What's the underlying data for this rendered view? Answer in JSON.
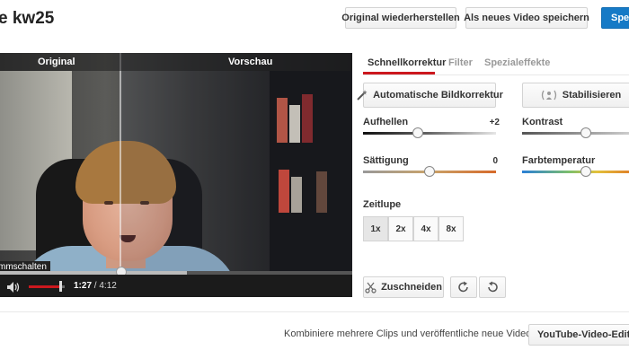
{
  "header": {
    "title": "e kw25",
    "restore_label": "Original wiederherstellen",
    "save_new_label": "Als neues Video speichern",
    "save_label": "Speic"
  },
  "video": {
    "original_label": "Original",
    "preview_label": "Vorschau",
    "mute_tooltip": "mmschalten",
    "current_time": "1:27",
    "total_time": "/ 4:12",
    "progress_fraction": 0.345,
    "played_fraction": 0.53,
    "volume_fraction": 0.9
  },
  "tabs": [
    {
      "label": "Schnellkorrektur",
      "active": true
    },
    {
      "label": "Filter",
      "active": false
    },
    {
      "label": "Spezialeffekte",
      "active": false
    }
  ],
  "quickfix": {
    "auto_fix_label": "Automatische Bildkorrektur",
    "stabilize_label": "Stabilisieren"
  },
  "sliders": {
    "brighten": {
      "label": "Aufhellen",
      "value": "+2",
      "fraction": 0.41
    },
    "contrast": {
      "label": "Kontrast",
      "value": "",
      "fraction": 0.6
    },
    "saturation": {
      "label": "Sättigung",
      "value": "0",
      "fraction": 0.5
    },
    "temperature": {
      "label": "Farbtemperatur",
      "value": "",
      "fraction": 0.6
    }
  },
  "slowmo": {
    "label": "Zeitlupe",
    "options": [
      "1x",
      "2x",
      "4x",
      "8x"
    ],
    "selected": "1x"
  },
  "tools": {
    "trim_label": "Zuschneiden"
  },
  "footer": {
    "text": "Kombiniere mehrere Clips und veröffentliche neue Videos.",
    "editor_label": "YouTube-Video-Editor te"
  },
  "colors": {
    "accent_red": "#cc181e",
    "brand_blue": "#167ac6"
  }
}
